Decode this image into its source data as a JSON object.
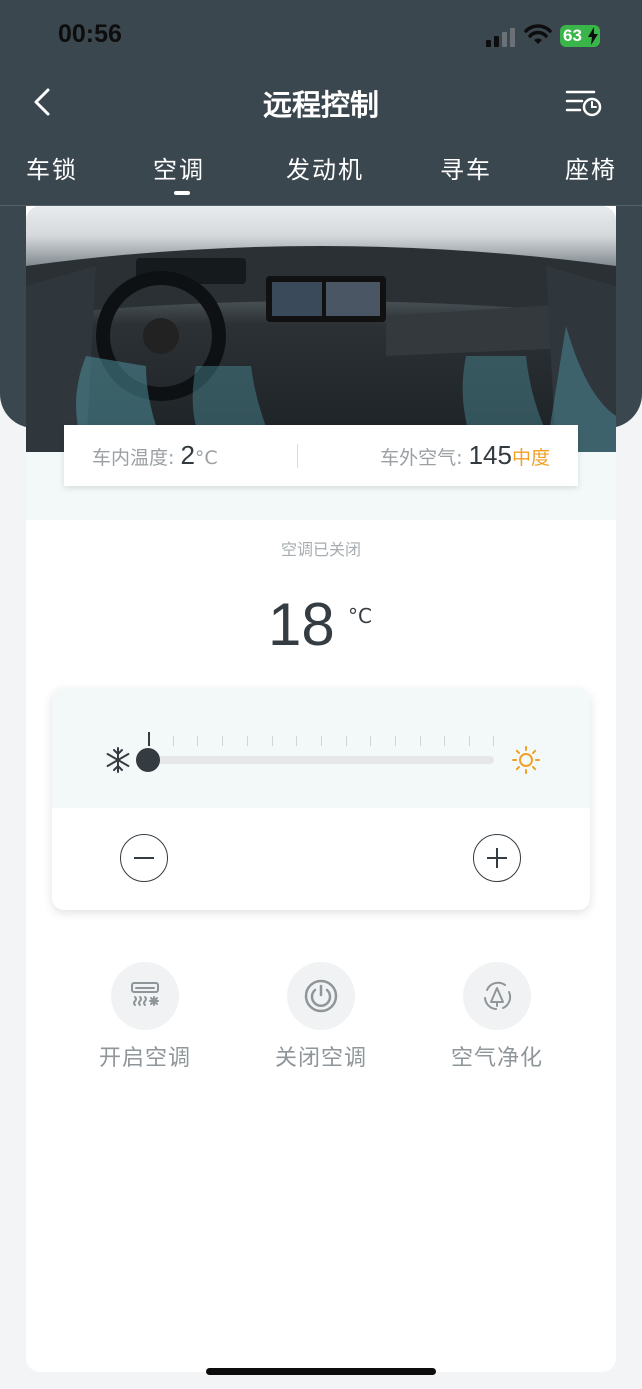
{
  "status_bar": {
    "time": "00:56",
    "battery": "63"
  },
  "nav": {
    "title": "远程控制",
    "back_icon": "chevron-left-icon",
    "history_icon": "list-clock-icon"
  },
  "tabs": [
    {
      "label": "车锁"
    },
    {
      "label": "空调",
      "active": true
    },
    {
      "label": "发动机"
    },
    {
      "label": "寻车"
    },
    {
      "label": "座椅"
    }
  ],
  "info": {
    "inside_label": "车内温度:",
    "inside_value": "2",
    "inside_unit": "°C",
    "outside_label": "车外空气:",
    "outside_value": "145",
    "outside_level": "中度",
    "outside_level_color": "#f0a028"
  },
  "ac": {
    "status": "空调已关闭",
    "temperature": "18",
    "unit": "°C",
    "slider_level": 0
  },
  "actions": [
    {
      "label": "开启空调",
      "icon": "ac-on-icon"
    },
    {
      "label": "关闭空调",
      "icon": "power-icon"
    },
    {
      "label": "空气净化",
      "icon": "air-purify-icon"
    }
  ],
  "colors": {
    "header_bg": "#3b474f",
    "accent_warm": "#f0a028",
    "dark": "#343c42"
  }
}
